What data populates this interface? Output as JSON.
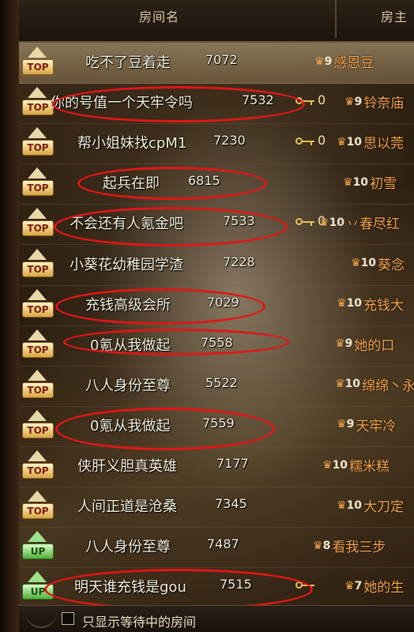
{
  "header": {
    "col_room": "房间名",
    "col_owner": "房主"
  },
  "footer": {
    "waiting_only_label": "只显示等待中的房间",
    "waiting_only_checked": false
  },
  "rooms": [
    {
      "badge": "TOP",
      "name": "吃不了豆着走",
      "number": "7072",
      "key_count": "",
      "level": "9",
      "owner": "感恩豆",
      "selected": true,
      "circled": false
    },
    {
      "badge": "TOP",
      "name": "你的号值一个天牢令吗",
      "number": "7532",
      "key_count": "0",
      "level": "9",
      "owner": "铃奈庙",
      "selected": false,
      "circled": true
    },
    {
      "badge": "TOP",
      "name": "帮小姐妹找cpM1",
      "number": "7230",
      "key_count": "0",
      "level": "10",
      "owner": "思以莞",
      "selected": false,
      "circled": false
    },
    {
      "badge": "TOP",
      "name": "起兵在即",
      "number": "6815",
      "key_count": "",
      "level": "10",
      "owner": "初雪",
      "selected": false,
      "circled": true
    },
    {
      "badge": "TOP",
      "name": "不会还有人氪金吧",
      "number": "7533",
      "key_count": "0",
      "level": "10",
      "owner": "丷春尽红",
      "selected": false,
      "circled": true
    },
    {
      "badge": "TOP",
      "name": "小葵花幼稚园学渣",
      "number": "7228",
      "key_count": "",
      "level": "10",
      "owner": "葵念",
      "selected": false,
      "circled": false
    },
    {
      "badge": "TOP",
      "name": "充钱高级会所",
      "number": "7029",
      "key_count": "",
      "level": "10",
      "owner": "充钱大",
      "selected": false,
      "circled": true
    },
    {
      "badge": "TOP",
      "name": "0氪从我做起",
      "number": "7558",
      "key_count": "",
      "level": "9",
      "owner": "她的口",
      "selected": false,
      "circled": true
    },
    {
      "badge": "TOP",
      "name": "八人身份至尊",
      "number": "5522",
      "key_count": "",
      "level": "10",
      "owner": "绵绵丶永",
      "selected": false,
      "circled": false
    },
    {
      "badge": "TOP",
      "name": "0氪从我做起",
      "number": "7559",
      "key_count": "",
      "level": "9",
      "owner": "天牢冷",
      "selected": false,
      "circled": true
    },
    {
      "badge": "TOP",
      "name": "侠肝义胆真英雄",
      "number": "7177",
      "key_count": "",
      "level": "10",
      "owner": "糯米糕",
      "selected": false,
      "circled": false
    },
    {
      "badge": "TOP",
      "name": "人间正道是沧桑",
      "number": "7345",
      "key_count": "",
      "level": "10",
      "owner": "大刀定",
      "selected": false,
      "circled": false
    },
    {
      "badge": "UP",
      "name": "八人身份至尊",
      "number": "7487",
      "key_count": "",
      "level": "8",
      "owner": "看我三步",
      "selected": false,
      "circled": false
    },
    {
      "badge": "UP",
      "name": "明天谁充钱是gou",
      "number": "7515",
      "key_count": "",
      "level": "7",
      "owner": "她的生",
      "selected": false,
      "circled": true
    }
  ],
  "colors": {
    "annotation_circle": "#e11616",
    "owner_text": "#f3a24a",
    "room_text": "#f6f0dd"
  }
}
